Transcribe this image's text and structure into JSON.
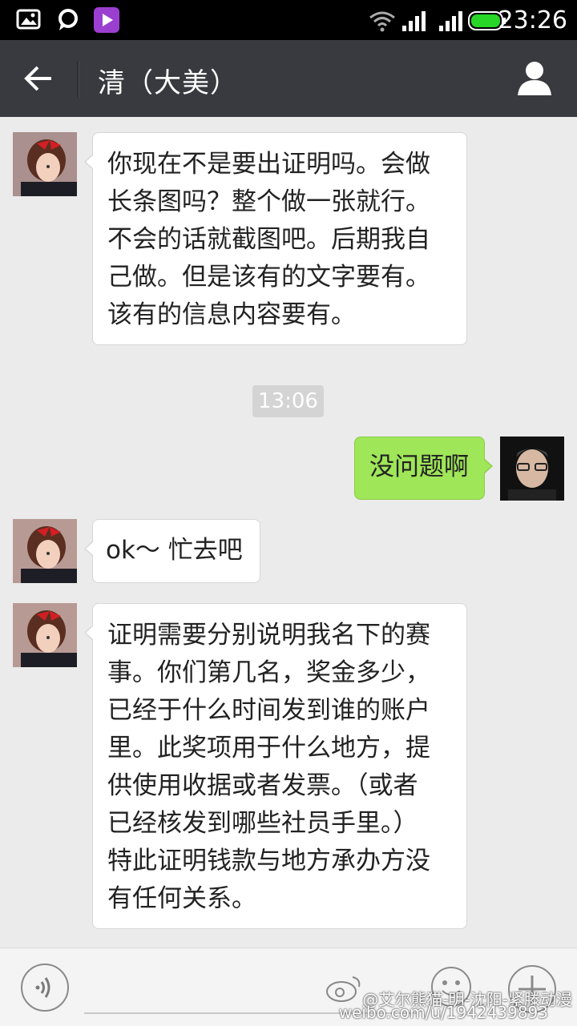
{
  "status_bar": {
    "time": "23:26"
  },
  "header": {
    "title": "清（大美）"
  },
  "messages": [
    {
      "side": "left",
      "text": "你现在不是要出证明吗。会做\n长条图吗？整个做一张就行。\n不会的话就截图吧。后期我自\n己做。但是该有的文字要有。\n该有的信息内容要有。"
    },
    {
      "side": "right",
      "text": "没问题啊"
    },
    {
      "side": "left",
      "text": "ok～ 忙去吧"
    },
    {
      "side": "left",
      "text": "证明需要分别说明我名下的赛\n事。你们第几名，奖金多少，\n已经于什么时间发到谁的账户\n里。此奖项用于什么地方，提\n供使用收据或者发票。（或者\n已经核发到哪些社员手里。）\n特此证明钱款与地方承办方没\n有任何关系。"
    }
  ],
  "timestamp": "13:06",
  "watermark": {
    "line1": "@艾尔熊猫-明-沈阳-紧滕动漫",
    "line2": "weibo.com/u/1942439893"
  },
  "colors": {
    "titlebar": "#393a3f",
    "background": "#ebebeb",
    "sent_bubble": "#9fe658"
  }
}
